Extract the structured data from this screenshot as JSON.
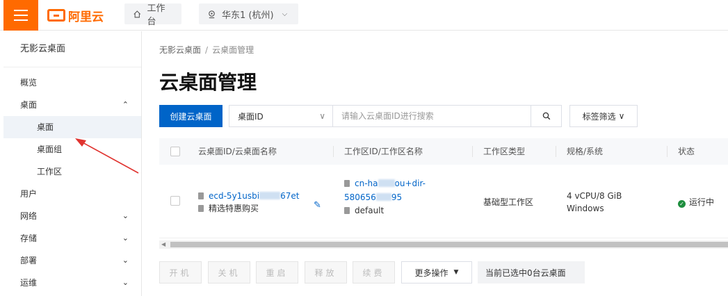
{
  "topbar": {
    "brand": "阿里云",
    "workbench_label": "工作台",
    "region_label": "华东1 (杭州)"
  },
  "sidebar": {
    "title": "无影云桌面",
    "items": [
      {
        "label": "概览"
      },
      {
        "label": "桌面",
        "expanded": true
      },
      {
        "label": "桌面",
        "active": true,
        "sub": true
      },
      {
        "label": "桌面组",
        "sub": true
      },
      {
        "label": "工作区",
        "sub": true
      },
      {
        "label": "用户"
      },
      {
        "label": "网络"
      },
      {
        "label": "存储"
      },
      {
        "label": "部署"
      },
      {
        "label": "运维"
      }
    ]
  },
  "main": {
    "breadcrumb": {
      "root": "无影云桌面",
      "sep": "/",
      "current": "云桌面管理"
    },
    "title": "云桌面管理",
    "create_button": "创建云桌面",
    "search_field_select": "桌面ID",
    "search_placeholder": "请输入云桌面ID进行搜索",
    "tag_filter": "标签筛选",
    "table": {
      "columns": [
        "云桌面ID/云桌面名称",
        "工作区ID/工作区名称",
        "工作区类型",
        "规格/系统",
        "状态"
      ],
      "rows": [
        {
          "desktop_id_prefix": "ecd-5y1usbi",
          "desktop_id_suffix": "67et",
          "desktop_name": "精选特惠购买",
          "workspace_id_line1_prefix": "cn-ha",
          "workspace_id_line1_suffix": "ou+dir-",
          "workspace_id_line2_prefix": "580656",
          "workspace_id_line2_suffix": "95",
          "workspace_name": "default",
          "workspace_type": "基础型工作区",
          "spec": "4 vCPU/8 GiB",
          "os": "Windows",
          "status": "运行中"
        }
      ]
    },
    "actions": {
      "start": "开机",
      "shutdown": "关机",
      "restart": "重启",
      "release": "释放",
      "renew": "续费",
      "more": "更多操作",
      "selection_info": "当前已选中0台云桌面"
    }
  },
  "colors": {
    "brand_orange": "#ff6a00",
    "primary_blue": "#0064c8",
    "status_green": "#1e8e3e",
    "annotation_red": "#e0332f"
  }
}
